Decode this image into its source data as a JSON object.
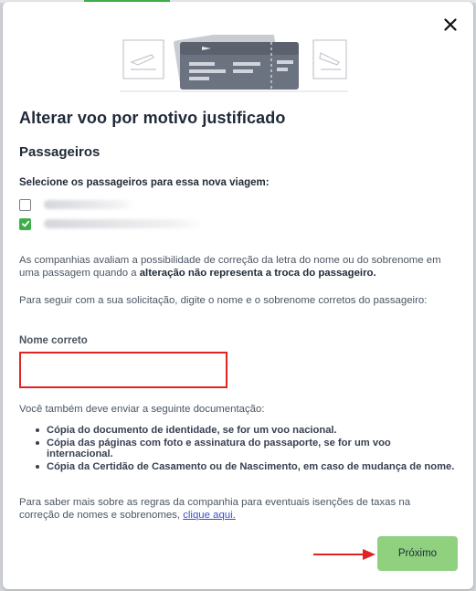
{
  "modal": {
    "title": "Alterar voo por motivo justificado",
    "close_icon": "close-icon"
  },
  "passengers": {
    "section_title": "Passageiros",
    "select_label": "Selecione os passageiros para essa nova viagem:",
    "items": [
      {
        "checked": false
      },
      {
        "checked": true
      }
    ]
  },
  "info": {
    "para1_plain": "As companhias avaliam a possibilidade de correção da letra do nome ou do sobrenome em uma passagem quando a ",
    "para1_bold": "alteração não representa a troca do passageiro.",
    "para2": "Para seguir com a sua solicitação, digite o nome e o sobrenome corretos do passageiro:"
  },
  "form": {
    "field_label": "Nome correto",
    "field_value": ""
  },
  "documents": {
    "intro": "Você também deve enviar a seguinte documentação:",
    "items": [
      "Cópia do documento de identidade, se for um voo nacional.",
      "Cópia das páginas com foto e assinatura do passaporte, se for um voo internacional.",
      "Cópia da Certidão de Casamento ou de Nascimento, em caso de mudança de nome."
    ]
  },
  "footer_note": {
    "text": "Para saber mais sobre as regras da companhia para eventuais isenções de taxas na correção de nomes e sobrenomes, ",
    "link": "clique aqui."
  },
  "actions": {
    "next_label": "Próximo"
  },
  "colors": {
    "checkbox_checked": "#3fae49",
    "next_button": "#8fd17f",
    "input_border": "#e02424",
    "arrow": "#e02424",
    "link": "#3b4cca"
  }
}
